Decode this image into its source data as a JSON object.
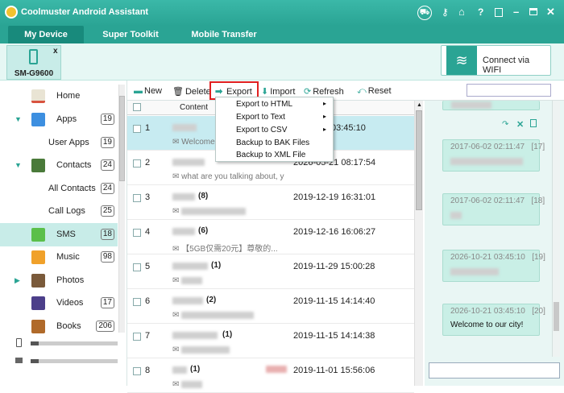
{
  "app": {
    "title": "Coolmuster Android Assistant"
  },
  "tabs": [
    {
      "label": "My Device"
    },
    {
      "label": "Super Toolkit"
    },
    {
      "label": "Mobile Transfer"
    }
  ],
  "device": {
    "name": "SM-G9600",
    "wifi_label": "Connect via WIFI"
  },
  "sidebar": {
    "items": [
      {
        "label": "Home",
        "count": ""
      },
      {
        "label": "Apps",
        "count": "19"
      },
      {
        "label": "User Apps",
        "count": "19"
      },
      {
        "label": "Contacts",
        "count": "24"
      },
      {
        "label": "All Contacts",
        "count": "24"
      },
      {
        "label": "Call Logs",
        "count": "25"
      },
      {
        "label": "SMS",
        "count": "18"
      },
      {
        "label": "Music",
        "count": "98"
      },
      {
        "label": "Photos",
        "count": ""
      },
      {
        "label": "Videos",
        "count": "17"
      },
      {
        "label": "Books",
        "count": "206"
      }
    ]
  },
  "toolbar": {
    "new": "New",
    "delete": "Delete",
    "export": "Export",
    "import": "Import",
    "refresh": "Refresh",
    "reset": "Reset"
  },
  "list": {
    "header": "Content",
    "rows": [
      {
        "num": "1",
        "count": "",
        "date": "03:45:10",
        "preview": "Welcome"
      },
      {
        "num": "2",
        "count": "",
        "date": "2026-05-21 08:17:54",
        "preview": "what are you talking about, y"
      },
      {
        "num": "3",
        "count": "(8)",
        "date": "2019-12-19 16:31:01",
        "preview": ""
      },
      {
        "num": "4",
        "count": "(6)",
        "date": "2019-12-16 16:06:27",
        "preview": "【5GB仅需20元】尊敬的..."
      },
      {
        "num": "5",
        "count": "(1)",
        "date": "2019-11-29 15:00:28",
        "preview": ""
      },
      {
        "num": "6",
        "count": "(2)",
        "date": "2019-11-15 14:14:40",
        "preview": ""
      },
      {
        "num": "7",
        "count": "(1)",
        "date": "2019-11-15 14:14:38",
        "preview": ""
      },
      {
        "num": "8",
        "count": "(1)",
        "date": "2019-11-01 15:56:06",
        "preview": ""
      }
    ]
  },
  "export_menu": [
    "Export to HTML",
    "Export to Text",
    "Export to CSV",
    "Backup to BAK Files",
    "Backup to XML File"
  ],
  "conversation": [
    {
      "meta": "2017-06-02 02:11:47   [17]",
      "text": ""
    },
    {
      "meta": "2017-06-02 02:11:47   [18]",
      "text": ""
    },
    {
      "meta": "2026-10-21 03:45:10   [19]",
      "text": ""
    },
    {
      "meta": "2026-10-21 03:45:10   [20]",
      "text": "Welcome to our city!"
    }
  ],
  "colors": {
    "accent": "#2aa494",
    "highlight_row": "#c7ebf1",
    "selected_side": "#c8ece8"
  }
}
